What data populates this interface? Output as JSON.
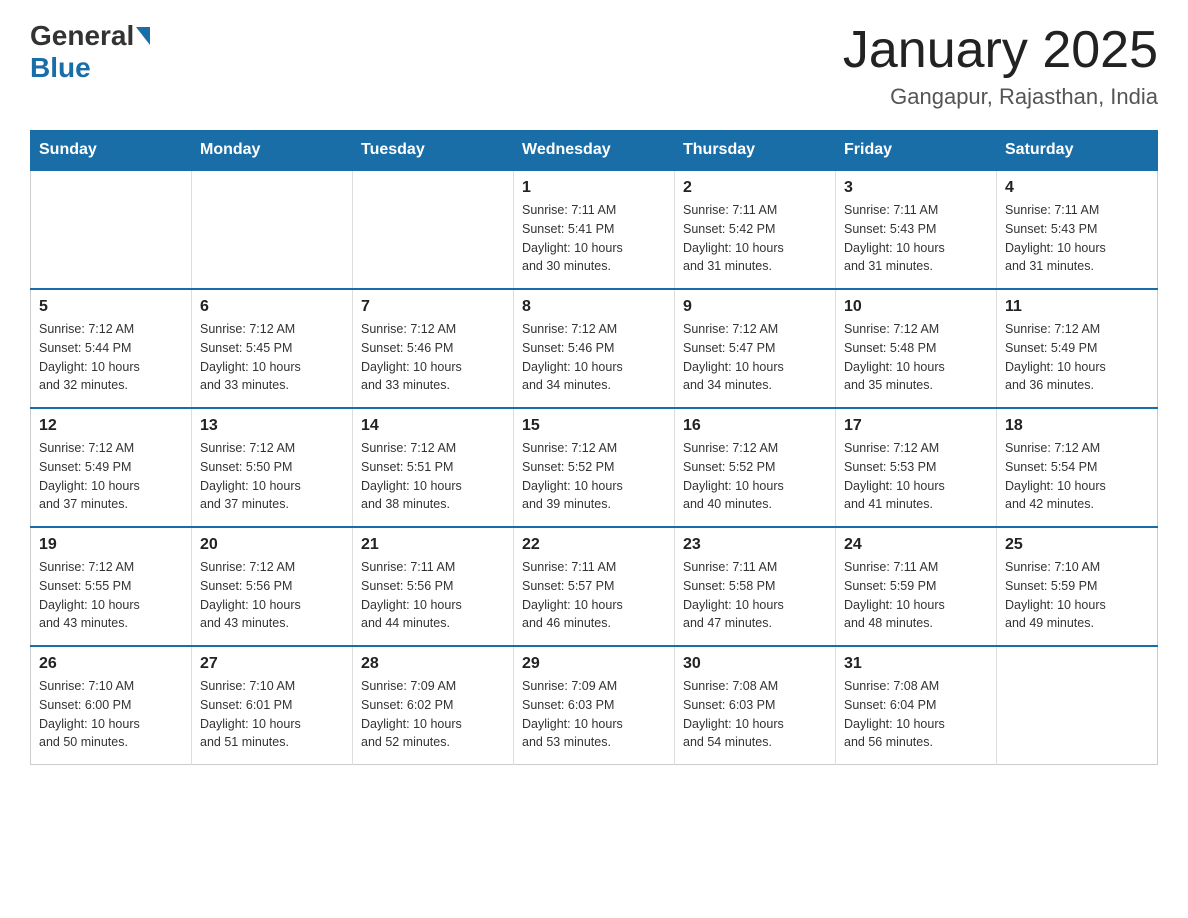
{
  "logo": {
    "general": "General",
    "blue": "Blue"
  },
  "header": {
    "month": "January 2025",
    "location": "Gangapur, Rajasthan, India"
  },
  "weekdays": [
    "Sunday",
    "Monday",
    "Tuesday",
    "Wednesday",
    "Thursday",
    "Friday",
    "Saturday"
  ],
  "weeks": [
    [
      {
        "day": "",
        "info": ""
      },
      {
        "day": "",
        "info": ""
      },
      {
        "day": "",
        "info": ""
      },
      {
        "day": "1",
        "info": "Sunrise: 7:11 AM\nSunset: 5:41 PM\nDaylight: 10 hours\nand 30 minutes."
      },
      {
        "day": "2",
        "info": "Sunrise: 7:11 AM\nSunset: 5:42 PM\nDaylight: 10 hours\nand 31 minutes."
      },
      {
        "day": "3",
        "info": "Sunrise: 7:11 AM\nSunset: 5:43 PM\nDaylight: 10 hours\nand 31 minutes."
      },
      {
        "day": "4",
        "info": "Sunrise: 7:11 AM\nSunset: 5:43 PM\nDaylight: 10 hours\nand 31 minutes."
      }
    ],
    [
      {
        "day": "5",
        "info": "Sunrise: 7:12 AM\nSunset: 5:44 PM\nDaylight: 10 hours\nand 32 minutes."
      },
      {
        "day": "6",
        "info": "Sunrise: 7:12 AM\nSunset: 5:45 PM\nDaylight: 10 hours\nand 33 minutes."
      },
      {
        "day": "7",
        "info": "Sunrise: 7:12 AM\nSunset: 5:46 PM\nDaylight: 10 hours\nand 33 minutes."
      },
      {
        "day": "8",
        "info": "Sunrise: 7:12 AM\nSunset: 5:46 PM\nDaylight: 10 hours\nand 34 minutes."
      },
      {
        "day": "9",
        "info": "Sunrise: 7:12 AM\nSunset: 5:47 PM\nDaylight: 10 hours\nand 34 minutes."
      },
      {
        "day": "10",
        "info": "Sunrise: 7:12 AM\nSunset: 5:48 PM\nDaylight: 10 hours\nand 35 minutes."
      },
      {
        "day": "11",
        "info": "Sunrise: 7:12 AM\nSunset: 5:49 PM\nDaylight: 10 hours\nand 36 minutes."
      }
    ],
    [
      {
        "day": "12",
        "info": "Sunrise: 7:12 AM\nSunset: 5:49 PM\nDaylight: 10 hours\nand 37 minutes."
      },
      {
        "day": "13",
        "info": "Sunrise: 7:12 AM\nSunset: 5:50 PM\nDaylight: 10 hours\nand 37 minutes."
      },
      {
        "day": "14",
        "info": "Sunrise: 7:12 AM\nSunset: 5:51 PM\nDaylight: 10 hours\nand 38 minutes."
      },
      {
        "day": "15",
        "info": "Sunrise: 7:12 AM\nSunset: 5:52 PM\nDaylight: 10 hours\nand 39 minutes."
      },
      {
        "day": "16",
        "info": "Sunrise: 7:12 AM\nSunset: 5:52 PM\nDaylight: 10 hours\nand 40 minutes."
      },
      {
        "day": "17",
        "info": "Sunrise: 7:12 AM\nSunset: 5:53 PM\nDaylight: 10 hours\nand 41 minutes."
      },
      {
        "day": "18",
        "info": "Sunrise: 7:12 AM\nSunset: 5:54 PM\nDaylight: 10 hours\nand 42 minutes."
      }
    ],
    [
      {
        "day": "19",
        "info": "Sunrise: 7:12 AM\nSunset: 5:55 PM\nDaylight: 10 hours\nand 43 minutes."
      },
      {
        "day": "20",
        "info": "Sunrise: 7:12 AM\nSunset: 5:56 PM\nDaylight: 10 hours\nand 43 minutes."
      },
      {
        "day": "21",
        "info": "Sunrise: 7:11 AM\nSunset: 5:56 PM\nDaylight: 10 hours\nand 44 minutes."
      },
      {
        "day": "22",
        "info": "Sunrise: 7:11 AM\nSunset: 5:57 PM\nDaylight: 10 hours\nand 46 minutes."
      },
      {
        "day": "23",
        "info": "Sunrise: 7:11 AM\nSunset: 5:58 PM\nDaylight: 10 hours\nand 47 minutes."
      },
      {
        "day": "24",
        "info": "Sunrise: 7:11 AM\nSunset: 5:59 PM\nDaylight: 10 hours\nand 48 minutes."
      },
      {
        "day": "25",
        "info": "Sunrise: 7:10 AM\nSunset: 5:59 PM\nDaylight: 10 hours\nand 49 minutes."
      }
    ],
    [
      {
        "day": "26",
        "info": "Sunrise: 7:10 AM\nSunset: 6:00 PM\nDaylight: 10 hours\nand 50 minutes."
      },
      {
        "day": "27",
        "info": "Sunrise: 7:10 AM\nSunset: 6:01 PM\nDaylight: 10 hours\nand 51 minutes."
      },
      {
        "day": "28",
        "info": "Sunrise: 7:09 AM\nSunset: 6:02 PM\nDaylight: 10 hours\nand 52 minutes."
      },
      {
        "day": "29",
        "info": "Sunrise: 7:09 AM\nSunset: 6:03 PM\nDaylight: 10 hours\nand 53 minutes."
      },
      {
        "day": "30",
        "info": "Sunrise: 7:08 AM\nSunset: 6:03 PM\nDaylight: 10 hours\nand 54 minutes."
      },
      {
        "day": "31",
        "info": "Sunrise: 7:08 AM\nSunset: 6:04 PM\nDaylight: 10 hours\nand 56 minutes."
      },
      {
        "day": "",
        "info": ""
      }
    ]
  ]
}
